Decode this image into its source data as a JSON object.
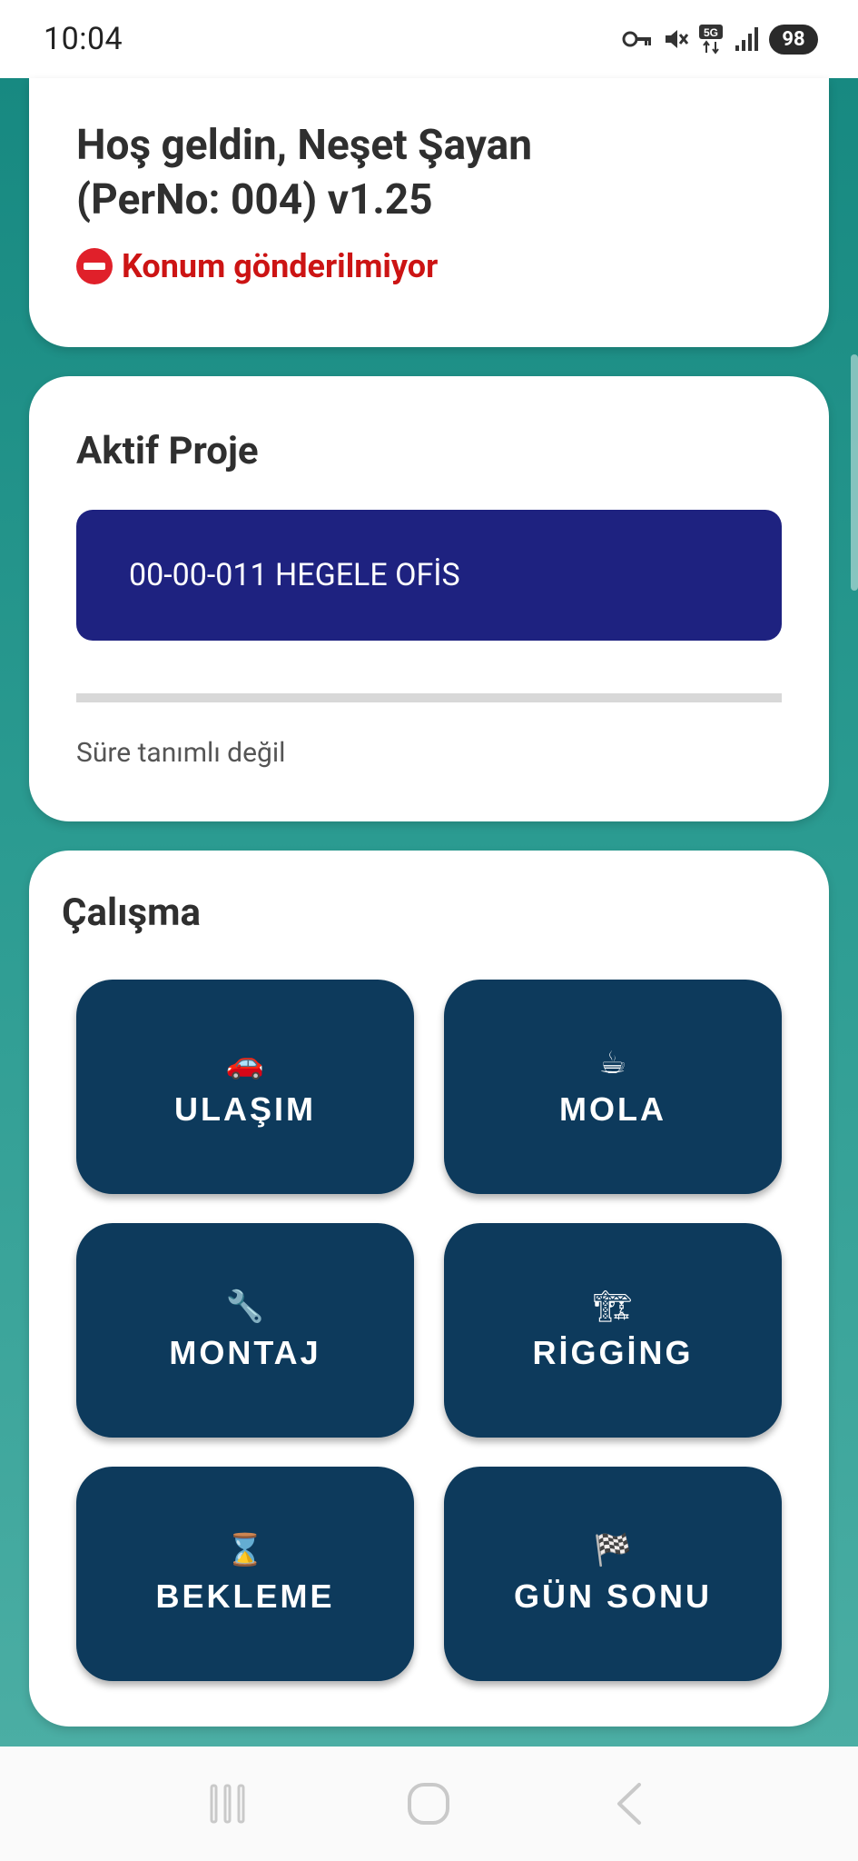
{
  "status_bar": {
    "time": "10:04",
    "battery": "98",
    "network": "5G",
    "icons": [
      "vpn-key-icon",
      "mute-icon",
      "5g-icon",
      "signal-icon",
      "battery-icon"
    ]
  },
  "welcome": {
    "line1": "Hoş geldin, Neşet Şayan",
    "line2": "(PerNo: 004)  v1.25",
    "location_status": "Konum gönderilmiyor",
    "location_icon": "no-entry-icon"
  },
  "project": {
    "title": "Aktif Proje",
    "active_project": "00-00-011 HEGELE OFİS",
    "duration_text": "Süre tanımlı değil"
  },
  "work": {
    "title": "Çalışma",
    "buttons": [
      {
        "emoji": "🚗",
        "icon": "car-icon",
        "label": "ULAŞIM"
      },
      {
        "emoji": "☕",
        "icon": "coffee-icon",
        "label": "MOLA"
      },
      {
        "emoji": "🔧",
        "icon": "wrench-icon",
        "label": "MONTAJ"
      },
      {
        "emoji": "🏗",
        "icon": "crane-icon",
        "label": "RİGGİNG"
      },
      {
        "emoji": "⌛",
        "icon": "hourglass-icon",
        "label": "BEKLEME"
      },
      {
        "emoji": "🏁",
        "icon": "checkered-flag-icon",
        "label": "GÜN SONU"
      }
    ]
  },
  "nav": {
    "items": [
      "recent-apps-icon",
      "home-icon",
      "back-icon"
    ]
  },
  "colors": {
    "background_top": "#15877f",
    "background_bottom": "#4fb0a6",
    "project_button": "#1e2280",
    "work_button": "#0d3a5c",
    "location_warning": "#cc1414"
  }
}
